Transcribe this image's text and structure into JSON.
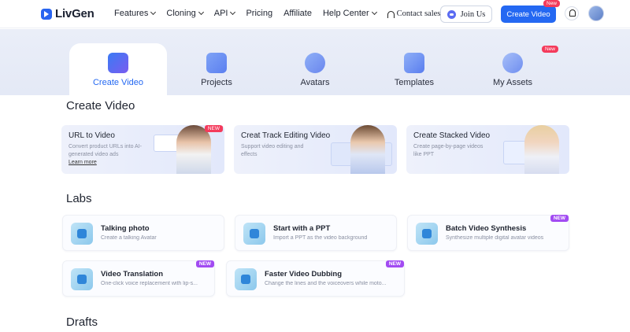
{
  "brand": {
    "name": "LivGen"
  },
  "nav": {
    "items": [
      "Features",
      "Cloning",
      "API",
      "Pricing",
      "Affiliate",
      "Help Center"
    ],
    "contact": "Contact sales",
    "join": "Join Us",
    "create": "Create Video",
    "create_badge": "New"
  },
  "tabs": [
    {
      "label": "Create Video",
      "icon": "create-video-icon"
    },
    {
      "label": "Projects",
      "icon": "projects-icon"
    },
    {
      "label": "Avatars",
      "icon": "avatars-icon"
    },
    {
      "label": "Templates",
      "icon": "templates-icon"
    },
    {
      "label": "My Assets",
      "icon": "my-assets-icon",
      "badge": "New"
    }
  ],
  "create_section": {
    "title": "Create Video",
    "cards": [
      {
        "title": "URL to Video",
        "desc": "Convert product URLs into AI-generated video ads",
        "link": "Learn more",
        "badge": "NEW"
      },
      {
        "title": "Creat Track Editing Video",
        "desc": "Support video editing and effects"
      },
      {
        "title": "Create Stacked Video",
        "desc": "Create page-by-page videos like PPT"
      }
    ]
  },
  "labs": {
    "title": "Labs",
    "items": [
      {
        "title": "Talking photo",
        "desc": "Create a talking Avatar"
      },
      {
        "title": "Start with a PPT",
        "desc": "Import a PPT as the video background"
      },
      {
        "title": "Batch Video Synthesis",
        "desc": "Synthesize multiple digital avatar videos",
        "badge": "NEW"
      },
      {
        "title": "Video Translation",
        "desc": "One-click voice replacement with lip-s...",
        "badge": "NEW"
      },
      {
        "title": "Faster Video Dubbing",
        "desc": "Change the lines and the voiceovers while moto...",
        "badge": "NEW"
      }
    ]
  },
  "drafts": {
    "title": "Drafts"
  },
  "colors": {
    "accent": "#2468f2",
    "badge_red": "#f43b5c",
    "badge_purple": "#a24bf2"
  }
}
